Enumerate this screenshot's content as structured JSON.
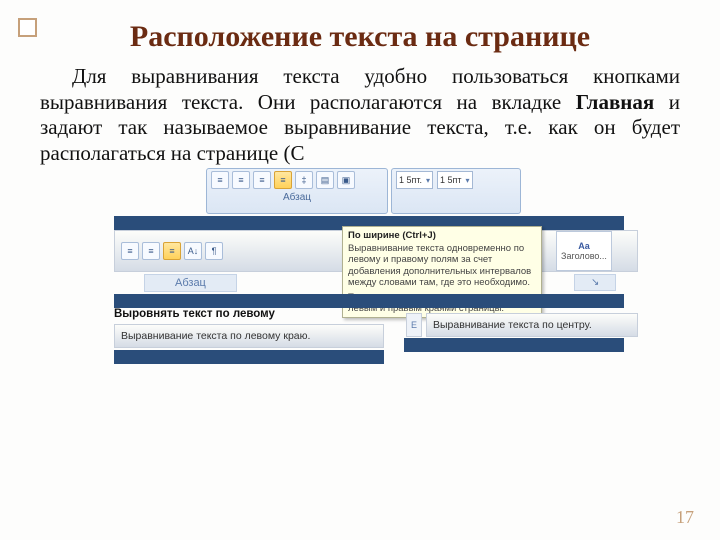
{
  "title": "Расположение текста на странице",
  "paragraph_html": "Для выравнивания текста удобно пользоваться кнопками выравнивания текста. Они располагаются на вкладке <b>Главная</b> и задают так называемое выравнивание текста, т.е. как он будет располагаться на странице (С",
  "page_number": "17",
  "ribbon": {
    "group_paragraph": "Абзац",
    "spacing1": "1 5пт.",
    "spacing2": "1 5пт",
    "style_heading": "Заголово..."
  },
  "tooltip_justify": {
    "title": "По ширине (Ctrl+J)",
    "line1": "Выравнивание текста одновременно по левому и правому полям за счет добавления дополнительных интервалов между словами там, где это необходимо.",
    "line2": "Текст распределяется равномерно между левым и правым краями страницы."
  },
  "tooltip_left": {
    "title": "Выровнять текст по левому",
    "body": "Выравнивание текста по левому краю."
  },
  "tooltip_center": {
    "body": "Выравнивание текста по центру."
  }
}
